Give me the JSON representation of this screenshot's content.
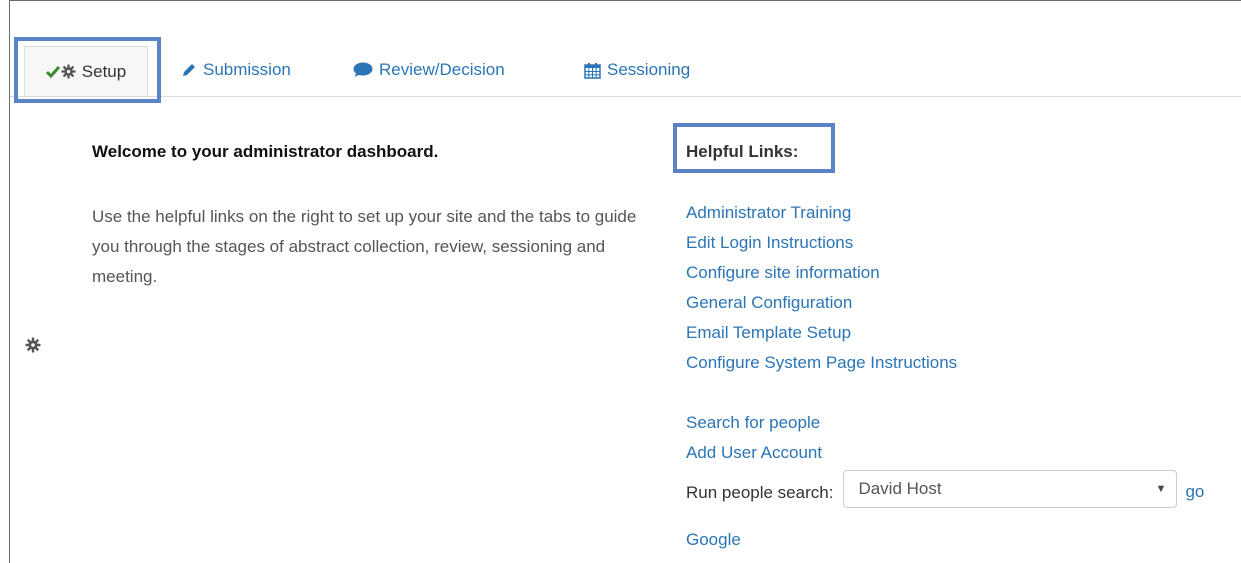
{
  "tabs": [
    {
      "label": "Setup",
      "icon": "check-gear-icon",
      "active": true
    },
    {
      "label": "Submission",
      "icon": "pencil-icon"
    },
    {
      "label": "Review/Decision",
      "icon": "comment-icon"
    },
    {
      "label": "Sessioning",
      "icon": "calendar-icon"
    }
  ],
  "main": {
    "welcome": "Welcome to your administrator dashboard.",
    "intro": "Use the helpful links on the right to set up your site and the tabs to guide you through the stages of abstract collection, review, sessioning and meeting."
  },
  "helpful": {
    "heading": "Helpful Links:",
    "links": [
      "Administrator Training",
      "Edit Login Instructions",
      "Configure site information",
      "General Configuration",
      "Email Template Setup",
      "Configure System Page Instructions"
    ],
    "people_links": [
      "Search for people",
      "Add User Account"
    ],
    "search_label": "Run people search:",
    "search_value": "David Host",
    "go_label": "go",
    "google_label": "Google"
  },
  "colors": {
    "link": "#2b75b6",
    "highlight": "#5b84c7",
    "check": "#3c8a2e"
  }
}
